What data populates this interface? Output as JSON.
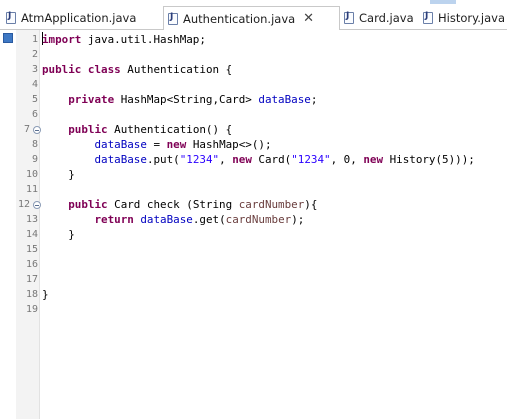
{
  "tabs": [
    {
      "label": "AtmApplication.java",
      "active": false
    },
    {
      "label": "Authentication.java",
      "active": true,
      "close": "✕"
    },
    {
      "label": "Card.java",
      "active": false
    },
    {
      "label": "History.java",
      "active": false
    }
  ],
  "editor": {
    "line_numbers": [
      "1",
      "2",
      "3",
      "4",
      "5",
      "6",
      "7",
      "8",
      "9",
      "10",
      "11",
      "12",
      "13",
      "14",
      "15",
      "16",
      "17",
      "18",
      "19"
    ],
    "lines": {
      "l1_kw": "import",
      "l1_rest": " java.util.HashMap;",
      "l3_kw1": "public",
      "l3_kw2": "class",
      "l3_rest": " Authentication {",
      "l5_kw": "private",
      "l5_rest": " HashMap<String,Card> ",
      "l5_field": "dataBase",
      "l5_end": ";",
      "l7_kw": "public",
      "l7_rest": " Authentication() {",
      "l8_field": "dataBase",
      "l8_mid": " = ",
      "l8_kw": "new",
      "l8_rest": " HashMap<>();",
      "l9_field": "dataBase",
      "l9_a": ".put(",
      "l9_s1": "\"1234\"",
      "l9_b": ", ",
      "l9_kw1": "new",
      "l9_c": " Card(",
      "l9_s2": "\"1234\"",
      "l9_d": ", 0, ",
      "l9_kw2": "new",
      "l9_e": " History(5)));",
      "l10": "}",
      "l12_kw": "public",
      "l12_a": " Card check (String ",
      "l12_param": "cardNumber",
      "l12_b": "){",
      "l13_kw": "return",
      "l13_field": "dataBase",
      "l13_a": ".get(",
      "l13_param": "cardNumber",
      "l13_b": ");",
      "l14": "}",
      "l18": "}"
    }
  },
  "colors": {
    "keyword": "#7f0055",
    "field": "#0000c0",
    "string": "#2a00ff",
    "parameter": "#6a3e3e"
  }
}
